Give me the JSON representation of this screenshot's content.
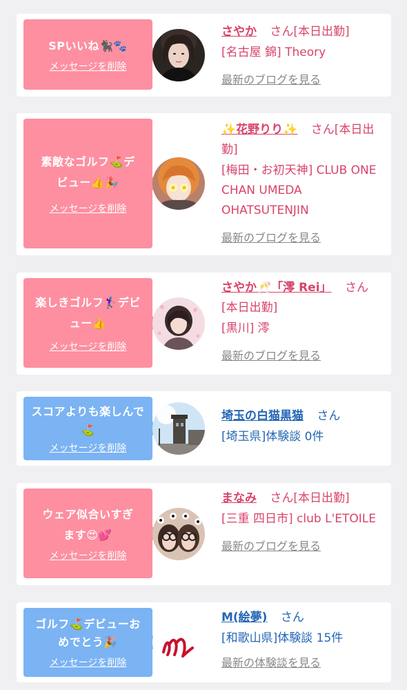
{
  "colors": {
    "pink_bubble": "#fd8fa1",
    "blue_bubble": "#7bb3f3",
    "cast_name": "#d9436a",
    "user_name": "#2466b5"
  },
  "cards": [
    {
      "message": "SPいいね🐈‍⬛🐾",
      "delete_label": "メッセージを削除",
      "name": "さやか",
      "honorific": "さん",
      "status": "[本日出勤]",
      "shop": "[名古屋 錦] Theory",
      "link": "最新のブログを見る"
    },
    {
      "message": "素敵なゴルフ⛳️デビュー👍🎉",
      "delete_label": "メッセージを削除",
      "name": "✨花野りり✨",
      "honorific": "さん",
      "status": "[本日出勤]",
      "shop": "[梅田・お初天神] CLUB ONE CHAN UMEDA OHATSUTENJIN",
      "link": "最新のブログを見る"
    },
    {
      "message": "楽しきゴルフ🏌️‍♀️デビュー👍",
      "delete_label": "メッセージを削除",
      "name": "さやか🥂「澪 Rei」",
      "honorific": "さん",
      "status": "[本日出勤]",
      "shop": "[黒川] 澪",
      "link": "最新のブログを見る"
    },
    {
      "message": "スコアよりも楽しんで⛳️",
      "delete_label": "メッセージを削除",
      "name": "埼玉の白猫黒猫",
      "honorific": "さん",
      "shop": "[埼玉県]体験談 0件"
    },
    {
      "message": "ウェア似合いすぎます😍💕",
      "delete_label": "メッセージを削除",
      "name": "まなみ",
      "honorific": "さん",
      "status": "[本日出勤]",
      "shop": "[三重 四日市] club L'ETOILE",
      "link": "最新のブログを見る"
    },
    {
      "message": "ゴルフ⛳️デビューおめでとう🎉",
      "delete_label": "メッセージを削除",
      "name": "M(絵夢)",
      "honorific": "さん",
      "shop": "[和歌山県]体験談 15件",
      "link": "最新の体験談を見る"
    }
  ]
}
